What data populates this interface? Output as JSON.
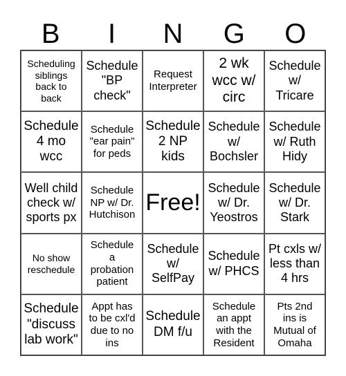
{
  "header": {
    "letters": [
      "B",
      "I",
      "N",
      "G",
      "O"
    ]
  },
  "cells": [
    [
      "Scheduling\nsiblings\nback to\nback",
      "Schedule\n\"BP\ncheck\"",
      "Request\nInterpreter",
      "2 wk\nwcc w/\ncirc",
      "Schedule\nw/\nTricare"
    ],
    [
      "Schedule\n4 mo\nwcc",
      "Schedule\n\"ear pain\"\nfor peds",
      "Schedule\n2 NP\nkids",
      "Schedule\nw/\nBochsler",
      "Schedule\nw/ Ruth\nHidy"
    ],
    [
      "Well child\ncheck w/\nsports px",
      "Schedule\nNP w/ Dr.\nHutchison",
      "Free!",
      "Schedule\nw/ Dr.\nYeostros",
      "Schedule\nw/ Dr.\nStark"
    ],
    [
      "No show\nreschedule",
      "Schedule\na\nprobation\npatient",
      "Schedule\nw/\nSelfPay",
      "Schedule\nw/ PHCS",
      "Pt cxls w/\nless than\n4 hrs"
    ],
    [
      "Schedule\n\"discuss\nlab work\"",
      "Appt has\nto be cxl'd\ndue to no\nins",
      "Schedule\nDM f/u",
      "Schedule\nan appt\nwith the\nResident",
      "Pts 2nd\nins is\nMutual of\nOmaha"
    ]
  ]
}
